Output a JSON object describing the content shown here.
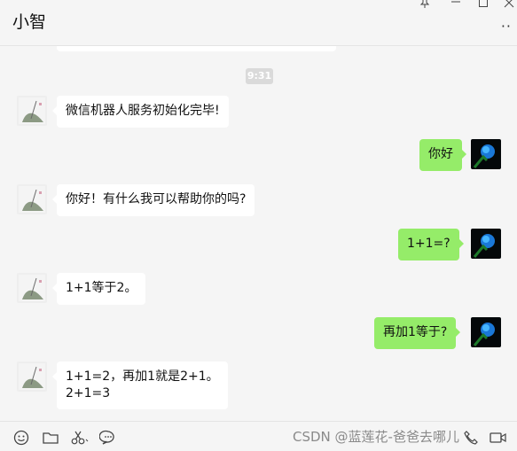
{
  "window": {
    "title": "小智",
    "controls": {
      "pin": "pin-icon",
      "minimize": "minimize-icon",
      "maximize": "maximize-icon",
      "close": "close-icon"
    },
    "more_label": "··"
  },
  "chat": {
    "time_divider": "9:31",
    "messages": [
      {
        "side": "left",
        "text": "微信机器人服务初始化完毕!"
      },
      {
        "side": "right",
        "text": "你好"
      },
      {
        "side": "left",
        "text": "你好！有什么我可以帮助你的吗?"
      },
      {
        "side": "right",
        "text": "1+1=?"
      },
      {
        "side": "left",
        "text": "1+1等于2。"
      },
      {
        "side": "right",
        "text": "再加1等于?"
      },
      {
        "side": "left",
        "lines": [
          "1+1=2，再加1就是2+1。",
          "2+1=3"
        ]
      }
    ]
  },
  "toolbar": {
    "icons": [
      "emoji-icon",
      "folder-icon",
      "scissors-icon",
      "chat-history-icon",
      "phone-icon",
      "video-icon"
    ]
  },
  "watermark": "CSDN @蓝莲花-爸爸去哪儿",
  "colors": {
    "background": "#f5f5f5",
    "bubble_self": "#95ec69",
    "bubble_other": "#ffffff"
  }
}
